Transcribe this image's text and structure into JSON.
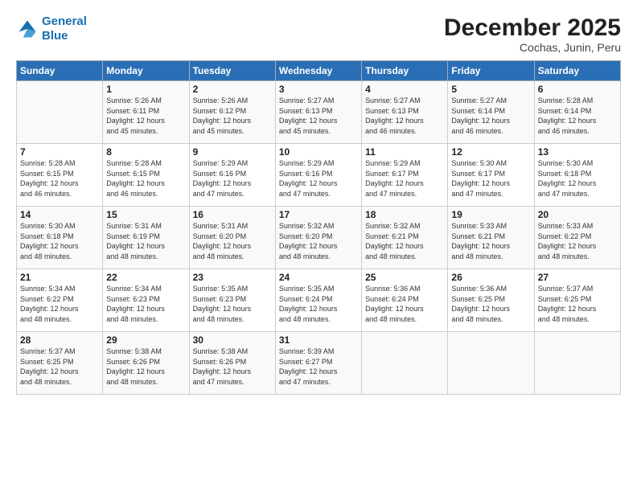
{
  "logo": {
    "line1": "General",
    "line2": "Blue"
  },
  "title": "December 2025",
  "subtitle": "Cochas, Junin, Peru",
  "days_header": [
    "Sunday",
    "Monday",
    "Tuesday",
    "Wednesday",
    "Thursday",
    "Friday",
    "Saturday"
  ],
  "weeks": [
    [
      {
        "num": "",
        "info": ""
      },
      {
        "num": "1",
        "info": "Sunrise: 5:26 AM\nSunset: 6:11 PM\nDaylight: 12 hours\nand 45 minutes."
      },
      {
        "num": "2",
        "info": "Sunrise: 5:26 AM\nSunset: 6:12 PM\nDaylight: 12 hours\nand 45 minutes."
      },
      {
        "num": "3",
        "info": "Sunrise: 5:27 AM\nSunset: 6:13 PM\nDaylight: 12 hours\nand 45 minutes."
      },
      {
        "num": "4",
        "info": "Sunrise: 5:27 AM\nSunset: 6:13 PM\nDaylight: 12 hours\nand 46 minutes."
      },
      {
        "num": "5",
        "info": "Sunrise: 5:27 AM\nSunset: 6:14 PM\nDaylight: 12 hours\nand 46 minutes."
      },
      {
        "num": "6",
        "info": "Sunrise: 5:28 AM\nSunset: 6:14 PM\nDaylight: 12 hours\nand 46 minutes."
      }
    ],
    [
      {
        "num": "7",
        "info": "Sunrise: 5:28 AM\nSunset: 6:15 PM\nDaylight: 12 hours\nand 46 minutes."
      },
      {
        "num": "8",
        "info": "Sunrise: 5:28 AM\nSunset: 6:15 PM\nDaylight: 12 hours\nand 46 minutes."
      },
      {
        "num": "9",
        "info": "Sunrise: 5:29 AM\nSunset: 6:16 PM\nDaylight: 12 hours\nand 47 minutes."
      },
      {
        "num": "10",
        "info": "Sunrise: 5:29 AM\nSunset: 6:16 PM\nDaylight: 12 hours\nand 47 minutes."
      },
      {
        "num": "11",
        "info": "Sunrise: 5:29 AM\nSunset: 6:17 PM\nDaylight: 12 hours\nand 47 minutes."
      },
      {
        "num": "12",
        "info": "Sunrise: 5:30 AM\nSunset: 6:17 PM\nDaylight: 12 hours\nand 47 minutes."
      },
      {
        "num": "13",
        "info": "Sunrise: 5:30 AM\nSunset: 6:18 PM\nDaylight: 12 hours\nand 47 minutes."
      }
    ],
    [
      {
        "num": "14",
        "info": "Sunrise: 5:30 AM\nSunset: 6:18 PM\nDaylight: 12 hours\nand 48 minutes."
      },
      {
        "num": "15",
        "info": "Sunrise: 5:31 AM\nSunset: 6:19 PM\nDaylight: 12 hours\nand 48 minutes."
      },
      {
        "num": "16",
        "info": "Sunrise: 5:31 AM\nSunset: 6:20 PM\nDaylight: 12 hours\nand 48 minutes."
      },
      {
        "num": "17",
        "info": "Sunrise: 5:32 AM\nSunset: 6:20 PM\nDaylight: 12 hours\nand 48 minutes."
      },
      {
        "num": "18",
        "info": "Sunrise: 5:32 AM\nSunset: 6:21 PM\nDaylight: 12 hours\nand 48 minutes."
      },
      {
        "num": "19",
        "info": "Sunrise: 5:33 AM\nSunset: 6:21 PM\nDaylight: 12 hours\nand 48 minutes."
      },
      {
        "num": "20",
        "info": "Sunrise: 5:33 AM\nSunset: 6:22 PM\nDaylight: 12 hours\nand 48 minutes."
      }
    ],
    [
      {
        "num": "21",
        "info": "Sunrise: 5:34 AM\nSunset: 6:22 PM\nDaylight: 12 hours\nand 48 minutes."
      },
      {
        "num": "22",
        "info": "Sunrise: 5:34 AM\nSunset: 6:23 PM\nDaylight: 12 hours\nand 48 minutes."
      },
      {
        "num": "23",
        "info": "Sunrise: 5:35 AM\nSunset: 6:23 PM\nDaylight: 12 hours\nand 48 minutes."
      },
      {
        "num": "24",
        "info": "Sunrise: 5:35 AM\nSunset: 6:24 PM\nDaylight: 12 hours\nand 48 minutes."
      },
      {
        "num": "25",
        "info": "Sunrise: 5:36 AM\nSunset: 6:24 PM\nDaylight: 12 hours\nand 48 minutes."
      },
      {
        "num": "26",
        "info": "Sunrise: 5:36 AM\nSunset: 6:25 PM\nDaylight: 12 hours\nand 48 minutes."
      },
      {
        "num": "27",
        "info": "Sunrise: 5:37 AM\nSunset: 6:25 PM\nDaylight: 12 hours\nand 48 minutes."
      }
    ],
    [
      {
        "num": "28",
        "info": "Sunrise: 5:37 AM\nSunset: 6:25 PM\nDaylight: 12 hours\nand 48 minutes."
      },
      {
        "num": "29",
        "info": "Sunrise: 5:38 AM\nSunset: 6:26 PM\nDaylight: 12 hours\nand 48 minutes."
      },
      {
        "num": "30",
        "info": "Sunrise: 5:38 AM\nSunset: 6:26 PM\nDaylight: 12 hours\nand 47 minutes."
      },
      {
        "num": "31",
        "info": "Sunrise: 5:39 AM\nSunset: 6:27 PM\nDaylight: 12 hours\nand 47 minutes."
      },
      {
        "num": "",
        "info": ""
      },
      {
        "num": "",
        "info": ""
      },
      {
        "num": "",
        "info": ""
      }
    ]
  ]
}
